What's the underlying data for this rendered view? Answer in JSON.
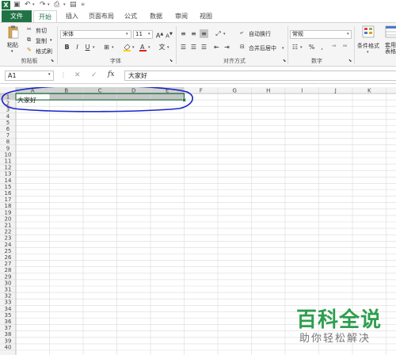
{
  "app": {
    "logo_letter": "X",
    "accent_color": "#217346"
  },
  "qat": {
    "icons": [
      "excel-logo",
      "save-icon",
      "undo-icon",
      "redo-icon",
      "print-preview-icon",
      "customize-icon"
    ]
  },
  "tabs": {
    "file": "文件",
    "home": "开始",
    "insert": "插入",
    "page_layout": "页面布局",
    "formulas": "公式",
    "data": "数据",
    "review": "审阅",
    "view": "视图"
  },
  "ribbon": {
    "clipboard": {
      "paste": "粘贴",
      "cut": "剪切",
      "copy": "复制",
      "format_painter": "格式刷",
      "label": "剪贴板"
    },
    "font": {
      "font_name": "宋体",
      "font_size": "11",
      "bold": "B",
      "italic": "I",
      "underline": "U",
      "grow_font": "A",
      "shrink_font": "A",
      "label": "字体"
    },
    "alignment": {
      "wrap_text": "自动换行",
      "merge_center": "合并后居中",
      "label": "对齐方式"
    },
    "number": {
      "format": "常规",
      "percent": "%",
      "comma": ",",
      "label": "数字"
    },
    "styles": {
      "conditional_format": "条件格式",
      "format_as_table": "套用\n表格格式"
    }
  },
  "formula_bar": {
    "name_box": "A1",
    "fx": "fx",
    "content": "大家好"
  },
  "sheet": {
    "columns": [
      "A",
      "B",
      "C",
      "D",
      "E",
      "F",
      "G",
      "H",
      "I",
      "J",
      "K"
    ],
    "rows": [
      "1",
      "2",
      "3",
      "4",
      "5",
      "6",
      "7",
      "8",
      "9",
      "10",
      "11",
      "12",
      "13",
      "14",
      "15",
      "16",
      "17",
      "18",
      "19",
      "20",
      "21",
      "22",
      "23",
      "24",
      "25",
      "26",
      "27",
      "28",
      "29",
      "30",
      "31",
      "32",
      "33",
      "34",
      "35",
      "36",
      "37",
      "38",
      "39",
      "40"
    ],
    "cell_A1": "大家好",
    "selection_color": "#c6c6c6",
    "annotation_color": "#1a24c8"
  },
  "watermark": {
    "title": "百科全说",
    "subtitle": "助你轻松解决",
    "color": "#2e9e4e"
  }
}
